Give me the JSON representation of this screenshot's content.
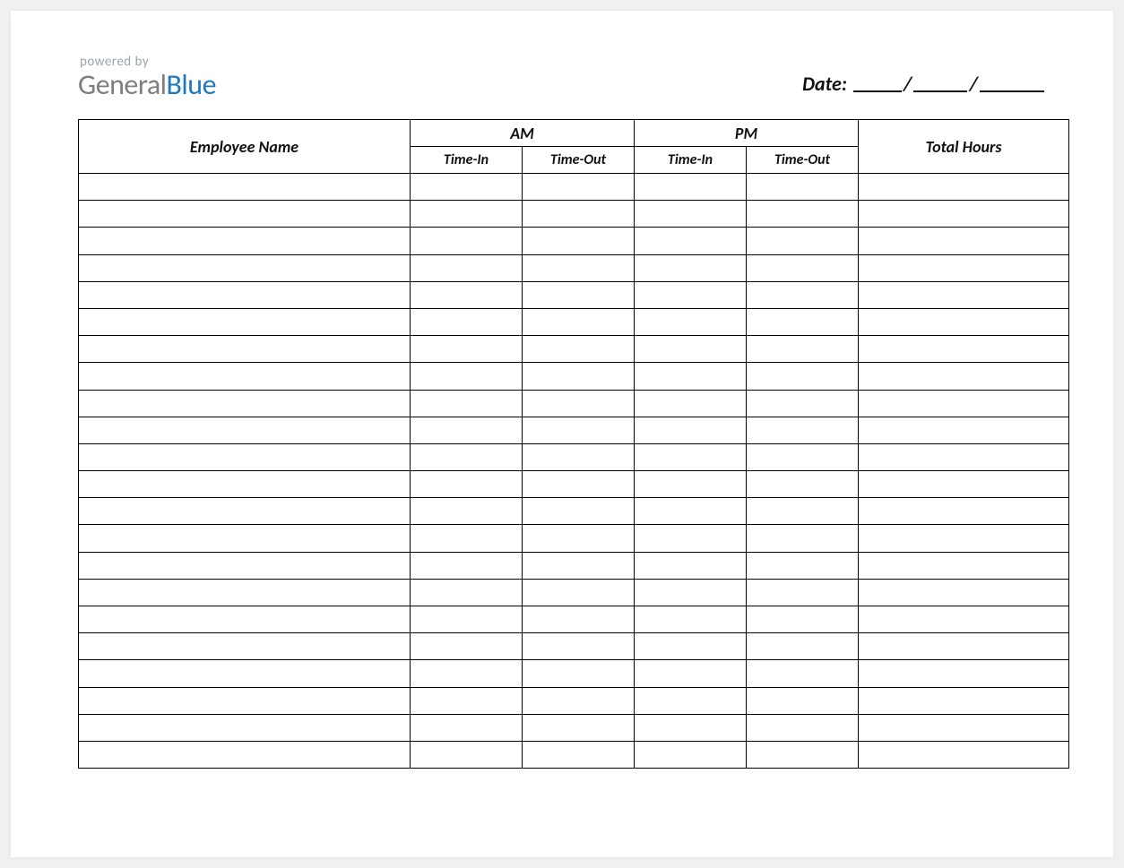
{
  "brand": {
    "powered_by": "powered by",
    "name_part1": "General",
    "name_part2": "Blue"
  },
  "date_label": "Date:",
  "columns": {
    "employee_name": "Employee Name",
    "am": "AM",
    "pm": "PM",
    "time_in": "Time-In",
    "time_out": "Time-Out",
    "total_hours": "Total Hours"
  },
  "row_count": 22,
  "rows": [
    {
      "name": "",
      "am_in": "",
      "am_out": "",
      "pm_in": "",
      "pm_out": "",
      "total": ""
    },
    {
      "name": "",
      "am_in": "",
      "am_out": "",
      "pm_in": "",
      "pm_out": "",
      "total": ""
    },
    {
      "name": "",
      "am_in": "",
      "am_out": "",
      "pm_in": "",
      "pm_out": "",
      "total": ""
    },
    {
      "name": "",
      "am_in": "",
      "am_out": "",
      "pm_in": "",
      "pm_out": "",
      "total": ""
    },
    {
      "name": "",
      "am_in": "",
      "am_out": "",
      "pm_in": "",
      "pm_out": "",
      "total": ""
    },
    {
      "name": "",
      "am_in": "",
      "am_out": "",
      "pm_in": "",
      "pm_out": "",
      "total": ""
    },
    {
      "name": "",
      "am_in": "",
      "am_out": "",
      "pm_in": "",
      "pm_out": "",
      "total": ""
    },
    {
      "name": "",
      "am_in": "",
      "am_out": "",
      "pm_in": "",
      "pm_out": "",
      "total": ""
    },
    {
      "name": "",
      "am_in": "",
      "am_out": "",
      "pm_in": "",
      "pm_out": "",
      "total": ""
    },
    {
      "name": "",
      "am_in": "",
      "am_out": "",
      "pm_in": "",
      "pm_out": "",
      "total": ""
    },
    {
      "name": "",
      "am_in": "",
      "am_out": "",
      "pm_in": "",
      "pm_out": "",
      "total": ""
    },
    {
      "name": "",
      "am_in": "",
      "am_out": "",
      "pm_in": "",
      "pm_out": "",
      "total": ""
    },
    {
      "name": "",
      "am_in": "",
      "am_out": "",
      "pm_in": "",
      "pm_out": "",
      "total": ""
    },
    {
      "name": "",
      "am_in": "",
      "am_out": "",
      "pm_in": "",
      "pm_out": "",
      "total": ""
    },
    {
      "name": "",
      "am_in": "",
      "am_out": "",
      "pm_in": "",
      "pm_out": "",
      "total": ""
    },
    {
      "name": "",
      "am_in": "",
      "am_out": "",
      "pm_in": "",
      "pm_out": "",
      "total": ""
    },
    {
      "name": "",
      "am_in": "",
      "am_out": "",
      "pm_in": "",
      "pm_out": "",
      "total": ""
    },
    {
      "name": "",
      "am_in": "",
      "am_out": "",
      "pm_in": "",
      "pm_out": "",
      "total": ""
    },
    {
      "name": "",
      "am_in": "",
      "am_out": "",
      "pm_in": "",
      "pm_out": "",
      "total": ""
    },
    {
      "name": "",
      "am_in": "",
      "am_out": "",
      "pm_in": "",
      "pm_out": "",
      "total": ""
    },
    {
      "name": "",
      "am_in": "",
      "am_out": "",
      "pm_in": "",
      "pm_out": "",
      "total": ""
    },
    {
      "name": "",
      "am_in": "",
      "am_out": "",
      "pm_in": "",
      "pm_out": "",
      "total": ""
    }
  ]
}
